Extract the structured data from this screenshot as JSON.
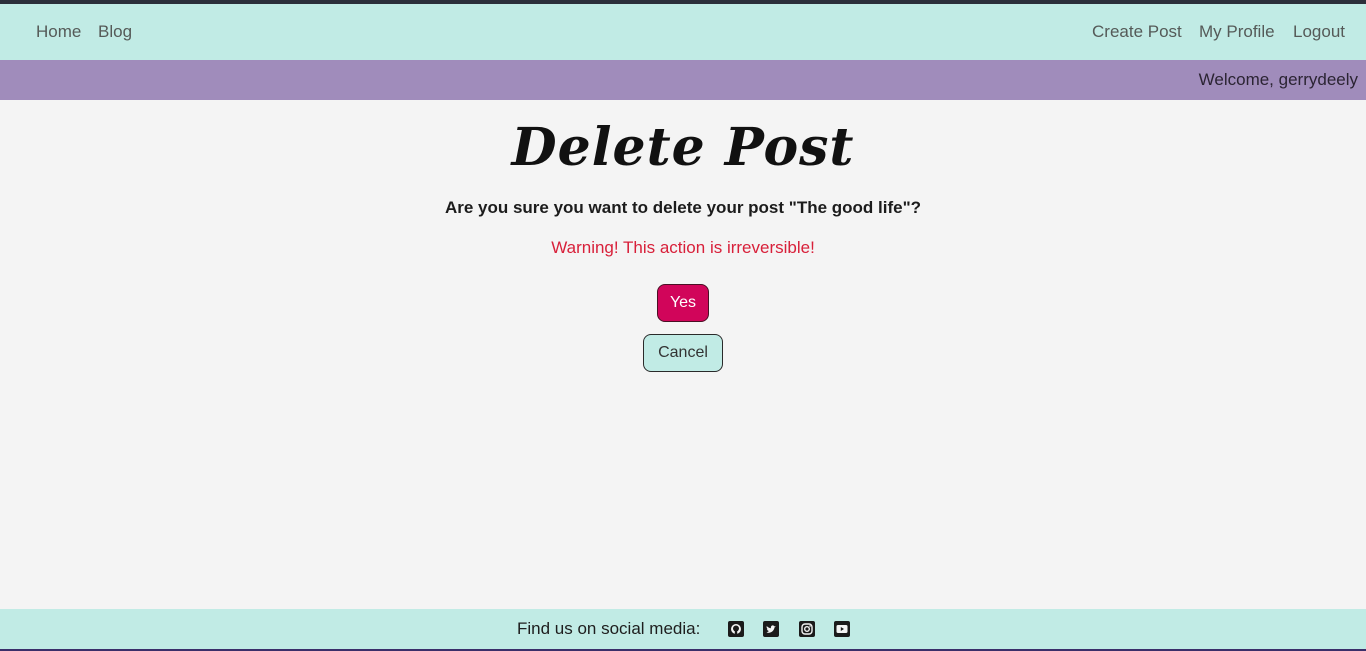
{
  "nav": {
    "left_links": [
      "Home",
      "Blog"
    ],
    "right_links": [
      "Create Post",
      "My Profile",
      "Logout"
    ]
  },
  "welcome": "Welcome, gerrydeely",
  "main": {
    "title": "Delete Post",
    "question": "Are you sure you want to delete your post \"The good life\"?",
    "warning": "Warning! This action is irreversible!",
    "yes_label": "Yes",
    "cancel_label": "Cancel"
  },
  "footer": {
    "label": "Find us on social media:",
    "icons": [
      "github-icon",
      "twitter-icon",
      "instagram-icon",
      "youtube-icon"
    ]
  },
  "colors": {
    "nav_bg": "#c1ebe5",
    "welcome_bg": "#a08cbb",
    "yes_button": "#d1055a",
    "warning_text": "#d8203a"
  }
}
